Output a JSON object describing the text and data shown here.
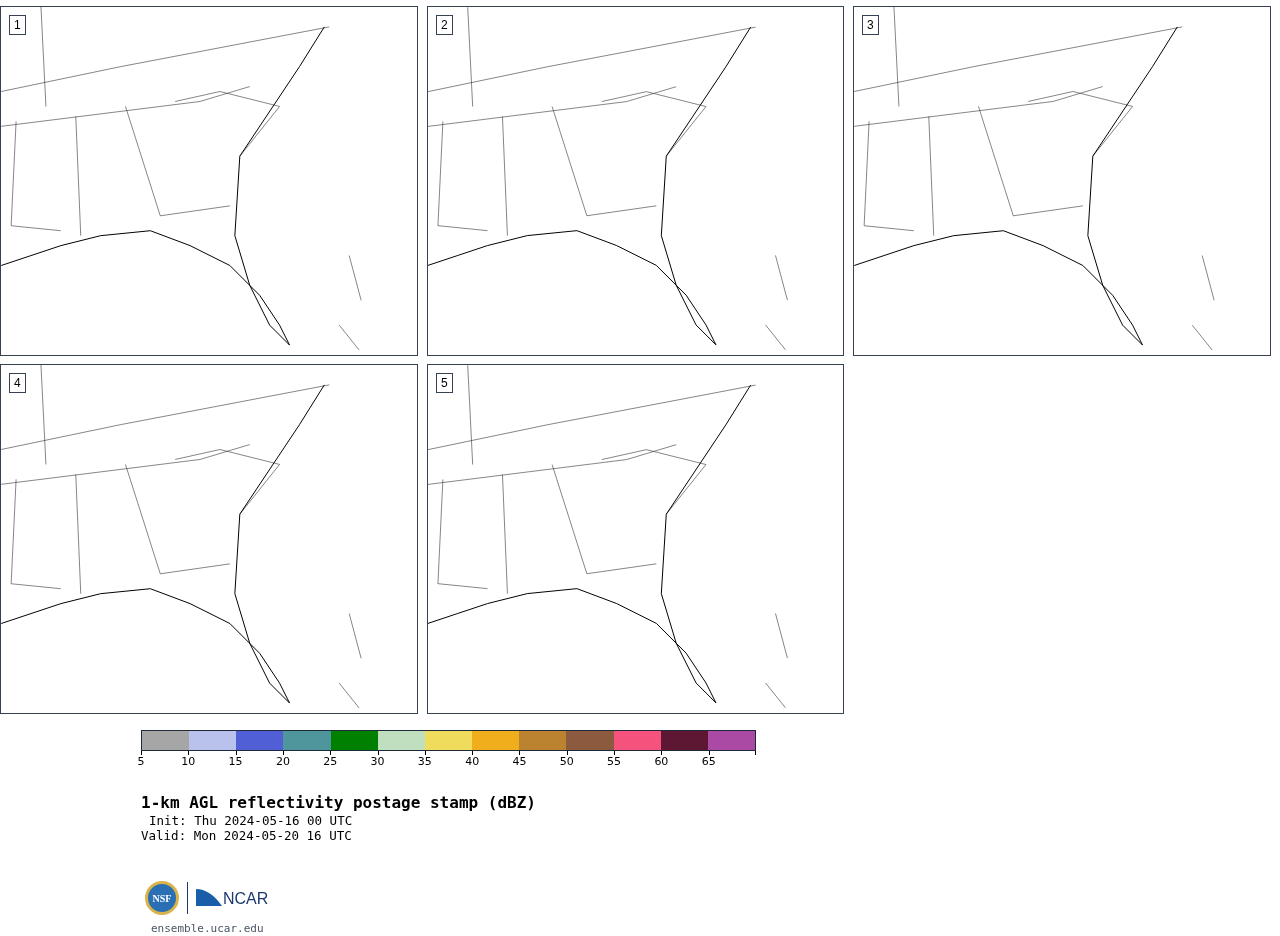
{
  "panels": [
    {
      "label": "1"
    },
    {
      "label": "2"
    },
    {
      "label": "3"
    },
    {
      "label": "4"
    },
    {
      "label": "5"
    }
  ],
  "colorbar": {
    "bins": [
      {
        "color": "#a6a6a6"
      },
      {
        "color": "#b8c2ed"
      },
      {
        "color": "#505fd6"
      },
      {
        "color": "#4f969c"
      },
      {
        "color": "#008000"
      },
      {
        "color": "#bfdfbf"
      },
      {
        "color": "#f0dc5c"
      },
      {
        "color": "#f0ae1c"
      },
      {
        "color": "#bb8330"
      },
      {
        "color": "#8c5a3f"
      },
      {
        "color": "#f5527e"
      },
      {
        "color": "#5e1733"
      },
      {
        "color": "#ab4aa5"
      }
    ],
    "ticks": [
      "5",
      "10",
      "15",
      "20",
      "25",
      "30",
      "35",
      "40",
      "45",
      "50",
      "55",
      "60",
      "65"
    ]
  },
  "title": "1-km AGL reflectivity postage stamp (dBZ)",
  "init": "Init: Thu 2024-05-16 00 UTC",
  "valid": "Valid: Mon 2024-05-20 16 UTC",
  "logo": {
    "seal": "NSF",
    "name": "NCAR"
  },
  "site": "ensemble.ucar.edu"
}
